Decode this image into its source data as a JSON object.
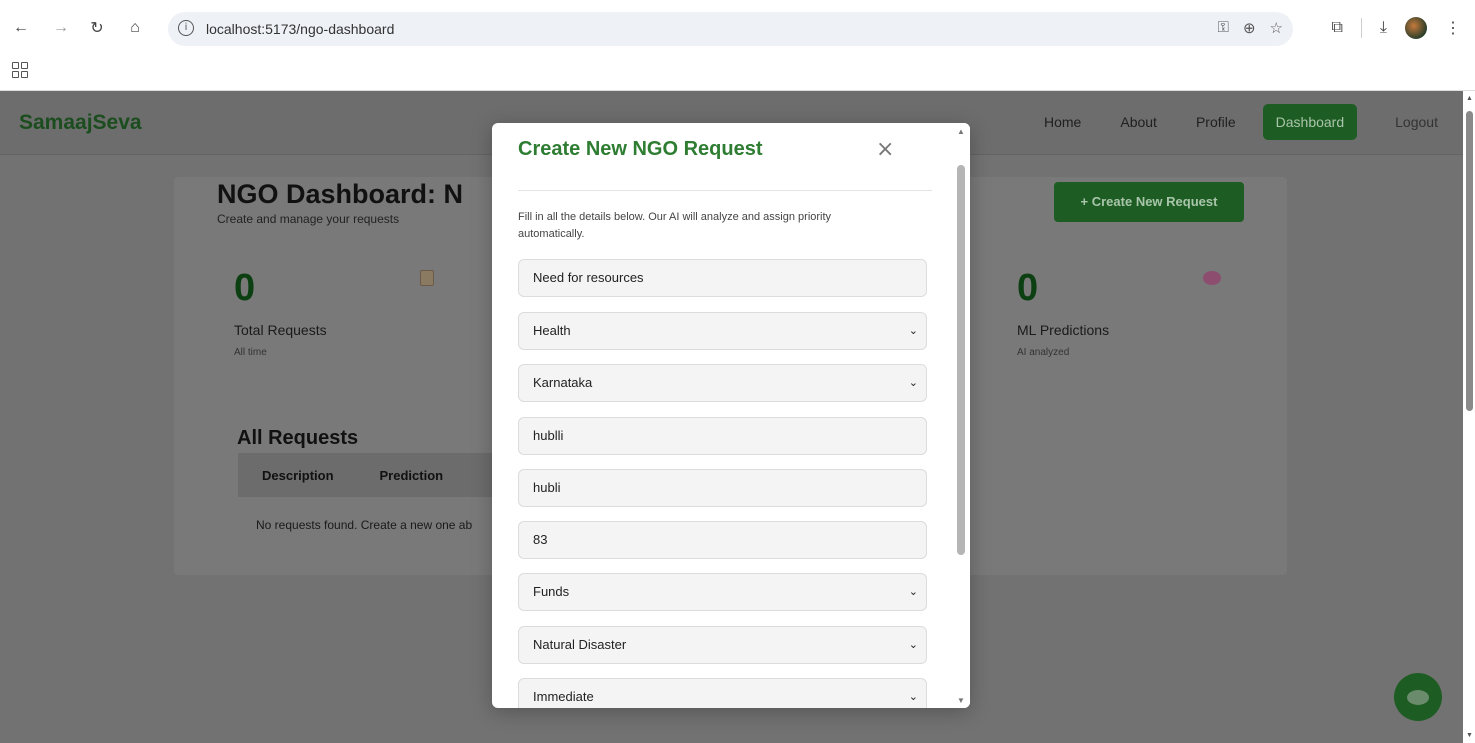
{
  "browser": {
    "url": "localhost:5173/ngo-dashboard"
  },
  "site": {
    "brand": "SamaajSeva",
    "nav": [
      "Home",
      "About",
      "Profile",
      "Dashboard",
      "Logout"
    ]
  },
  "dashboard": {
    "title": "NGO Dashboard: N",
    "subtitle": "Create and manage your requests",
    "create_button": "+ Create New Request",
    "stats": [
      {
        "value": "0",
        "label": "Total Requests",
        "sub": "All time",
        "icon": "clipboard-icon"
      },
      {
        "value": "0",
        "label": "ML Predictions",
        "sub": "AI analyzed",
        "icon": "brain-icon"
      }
    ],
    "requests_title": "All Requests",
    "table_headers": [
      "Description",
      "Prediction"
    ],
    "empty_message": "No requests found. Create a new one ab"
  },
  "modal": {
    "title": "Create New NGO Request",
    "close": "×",
    "hint": "Fill in all the details below. Our AI will analyze and assign priority automatically.",
    "fields": [
      {
        "type": "input",
        "value": "Need for resources"
      },
      {
        "type": "select",
        "value": "Health"
      },
      {
        "type": "select",
        "value": "Karnataka"
      },
      {
        "type": "input",
        "value": "hublli"
      },
      {
        "type": "input",
        "value": "hubli"
      },
      {
        "type": "input",
        "value": "83"
      },
      {
        "type": "select",
        "value": "Funds"
      },
      {
        "type": "select",
        "value": "Natural Disaster"
      },
      {
        "type": "select",
        "value": "Immediate"
      }
    ]
  },
  "colors": {
    "brand_green": "#2e7d32",
    "button_green": "#1d5c22",
    "overlay": "#727272"
  }
}
